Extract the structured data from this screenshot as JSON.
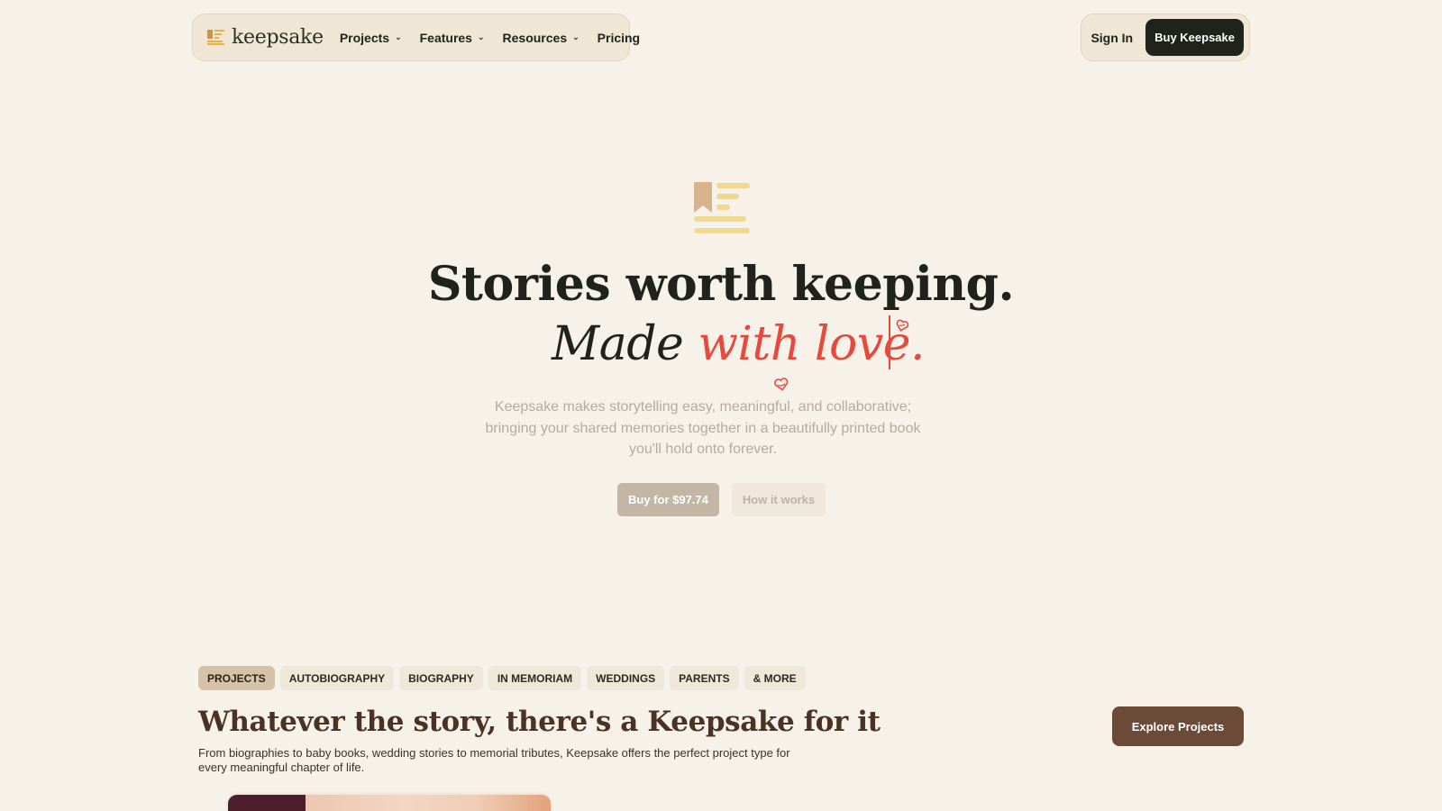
{
  "nav": {
    "brand": "keepsake",
    "items": [
      {
        "label": "Projects",
        "has_dropdown": true
      },
      {
        "label": "Features",
        "has_dropdown": true
      },
      {
        "label": "Resources",
        "has_dropdown": true
      },
      {
        "label": "Pricing",
        "has_dropdown": false
      }
    ],
    "sign_in": "Sign In",
    "buy": "Buy Keepsake"
  },
  "hero": {
    "line1": "Stories worth keeping.",
    "line2_plain": "Made ",
    "line2_accent": "with love.",
    "description": "Keepsake makes storytelling easy, meaningful, and collaborative; bringing your shared memories together in a beautifully printed book you'll hold onto forever.",
    "buy_cta": "Buy for $97.74",
    "how_cta": "How it works"
  },
  "projects": {
    "chips": [
      {
        "label": "PROJECTS",
        "active": true
      },
      {
        "label": "AUTOBIOGRAPHY",
        "active": false
      },
      {
        "label": "BIOGRAPHY",
        "active": false
      },
      {
        "label": "IN MEMORIAM",
        "active": false
      },
      {
        "label": "WEDDINGS",
        "active": false
      },
      {
        "label": "PARENTS",
        "active": false
      },
      {
        "label": "& MORE",
        "active": false
      }
    ],
    "title": "Whatever the story, there's a Keepsake for it",
    "description": "From biographies to baby books, wedding stories to memorial tributes, Keepsake offers the perfect project type for every meaningful chapter of life.",
    "explore": "Explore Projects"
  },
  "colors": {
    "background": "#f6f1e9",
    "accent_red": "#e8493d",
    "dark_button": "#1e241c",
    "brown_button": "#6b4a37",
    "chip_active": "#d6c3a7"
  },
  "icons": [
    "keepsake-logo-icon",
    "chevron-down-icon",
    "heart-icon",
    "bookmark-lines-icon"
  ]
}
